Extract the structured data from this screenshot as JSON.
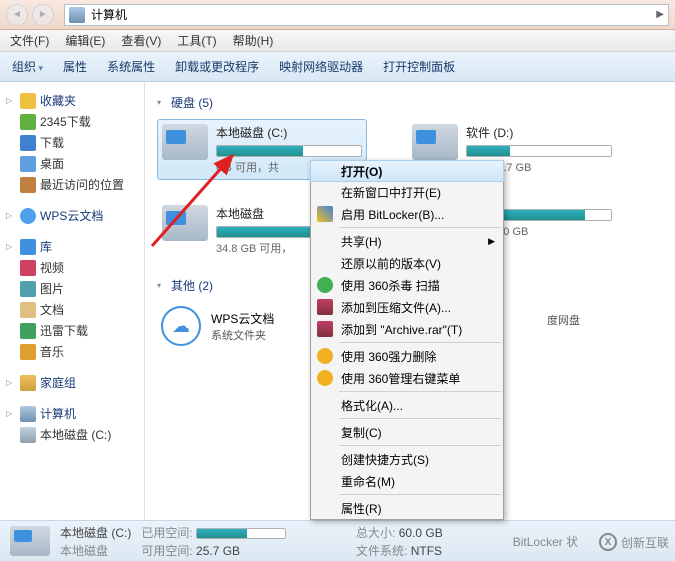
{
  "titlebar": {
    "location": "计算机"
  },
  "menubar": [
    "文件(F)",
    "编辑(E)",
    "查看(V)",
    "工具(T)",
    "帮助(H)"
  ],
  "toolbar": [
    "组织",
    "属性",
    "系统属性",
    "卸载或更改程序",
    "映射网络驱动器",
    "打开控制面板"
  ],
  "sidebar": {
    "fav": {
      "label": "收藏夹",
      "items": [
        "2345下载",
        "下载",
        "桌面",
        "最近访问的位置"
      ]
    },
    "cloud": {
      "label": "WPS云文档"
    },
    "lib": {
      "label": "库",
      "items": [
        "视频",
        "图片",
        "文档",
        "迅雷下载",
        "音乐"
      ]
    },
    "home": {
      "label": "家庭组"
    },
    "pc": {
      "label": "计算机",
      "items": [
        "本地磁盘 (C:)"
      ]
    }
  },
  "main": {
    "drives_header": "硬盘 (5)",
    "other_header": "其他 (2)",
    "drives": [
      {
        "name": "本地磁盘 (C:)",
        "text": "GB 可用，共",
        "fill": 60
      },
      {
        "name": "软件 (D:)",
        "text": "，共 51.7 GB",
        "fill": 30
      },
      {
        "name": "本地磁盘",
        "text": "34.8 GB 可用，",
        "fill": 78
      },
      {
        "name": "",
        "text": "，共 310 GB",
        "fill": 82
      }
    ],
    "other_cloud": {
      "name": "WPS云文档",
      "sub": "系统文件夹"
    },
    "other_right": "度网盘"
  },
  "context": {
    "items": [
      {
        "label": "打开(O)",
        "bold": true,
        "hover": true
      },
      {
        "label": "在新窗口中打开(E)"
      },
      {
        "label": "启用 BitLocker(B)...",
        "icon": "ci-shield"
      },
      {
        "sep": true
      },
      {
        "label": "共享(H)",
        "sub": true
      },
      {
        "label": "还原以前的版本(V)"
      },
      {
        "label": "使用 360杀毒 扫描",
        "icon": "ci-360"
      },
      {
        "label": "添加到压缩文件(A)...",
        "icon": "ci-rar"
      },
      {
        "label": "添加到 \"Archive.rar\"(T)",
        "icon": "ci-rar"
      },
      {
        "sep": true
      },
      {
        "label": "使用 360强力删除",
        "icon": "ci-360m"
      },
      {
        "label": "使用 360管理右键菜单",
        "icon": "ci-360m"
      },
      {
        "sep": true
      },
      {
        "label": "格式化(A)..."
      },
      {
        "sep": true
      },
      {
        "label": "复制(C)"
      },
      {
        "sep": true
      },
      {
        "label": "创建快捷方式(S)"
      },
      {
        "label": "重命名(M)"
      },
      {
        "sep": true
      },
      {
        "label": "属性(R)"
      }
    ]
  },
  "status": {
    "drive": "本地磁盘 (C:)",
    "sub": "本地磁盘",
    "used_label": "已用空间:",
    "free_label": "可用空间:",
    "free_val": "25.7 GB",
    "total_label": "总大小:",
    "total_val": "60.0 GB",
    "fs_label": "文件系统:",
    "fs_val": "NTFS",
    "bl": "BitLocker 状",
    "fill": 57
  },
  "watermark": "创新互联"
}
